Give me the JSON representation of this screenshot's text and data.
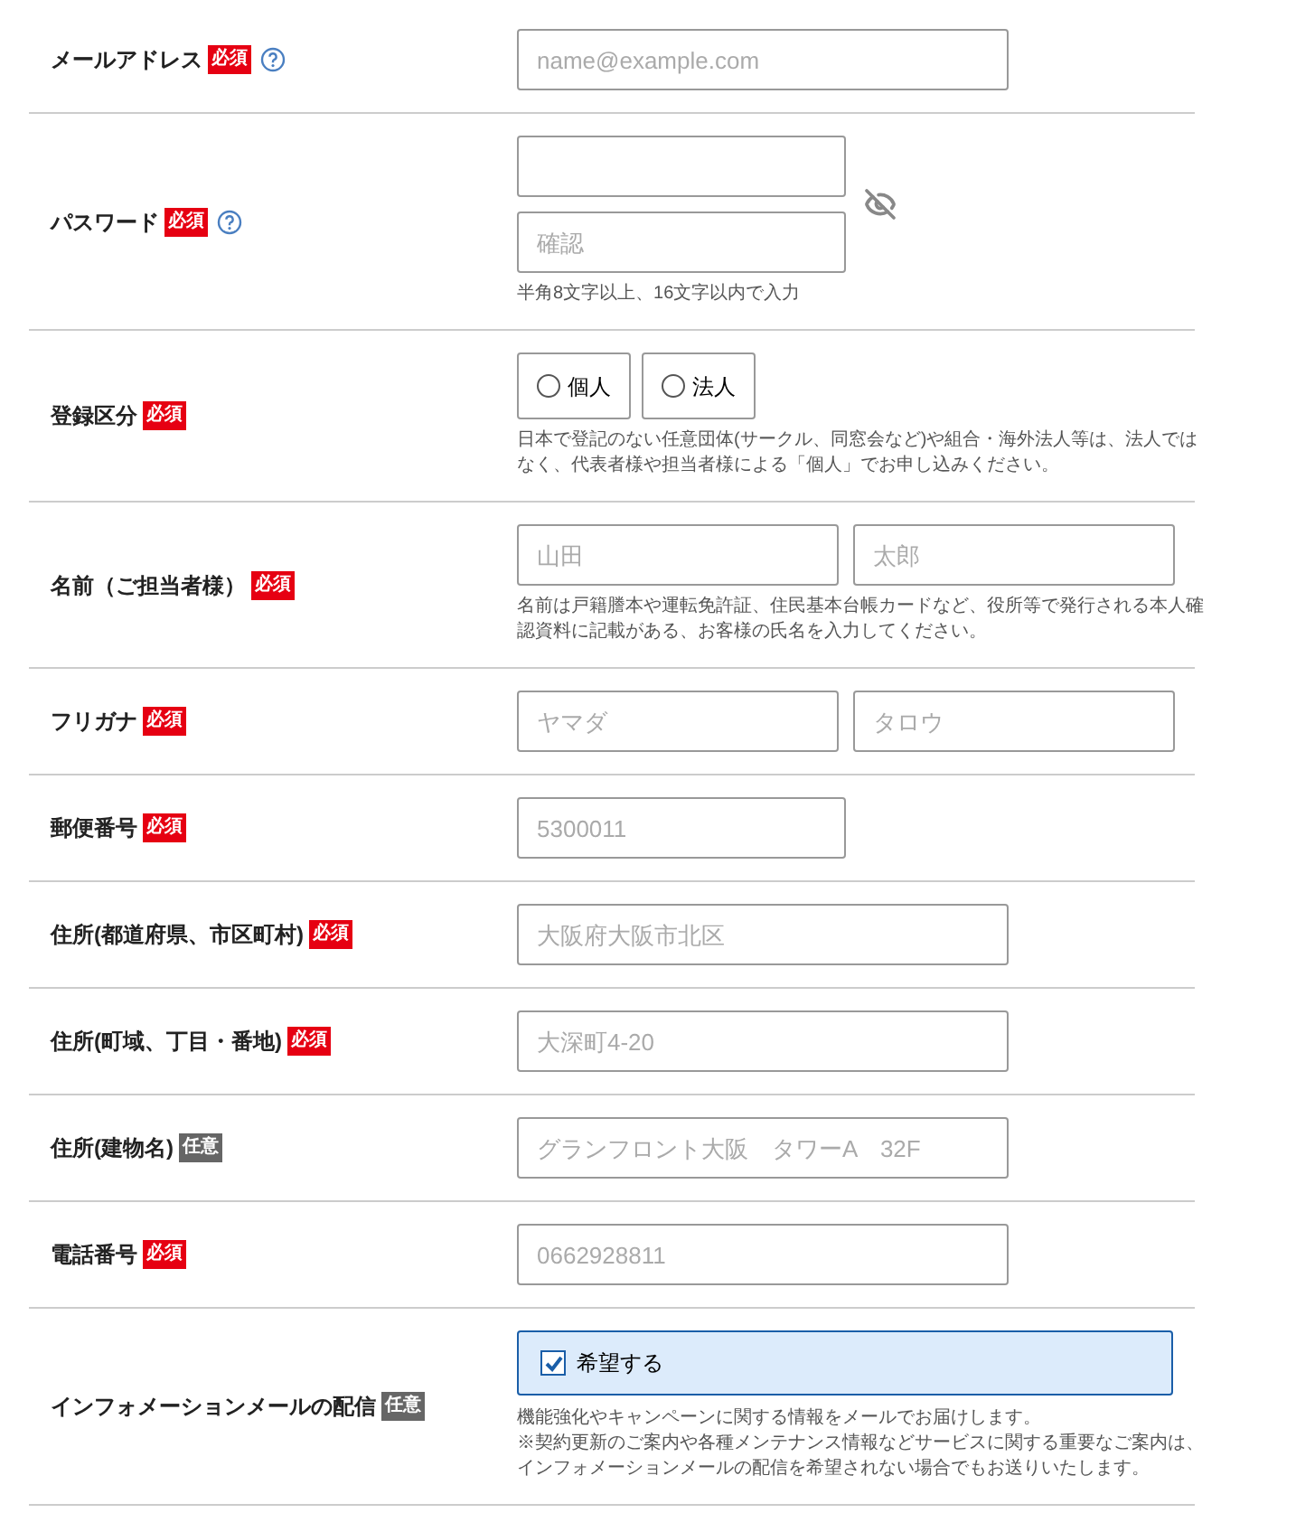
{
  "rows": [
    {
      "kind": "wide",
      "label": "メールアドレス",
      "badge": {
        "text": "必須",
        "kind": "required"
      },
      "help": true,
      "fields": [
        {
          "placeholder": "name@example.com"
        }
      ]
    },
    {
      "kind": "password",
      "label": "パスワード",
      "badge": {
        "text": "必須",
        "kind": "required"
      },
      "help": true,
      "password_visible": false,
      "confirm_field": {
        "placeholder": "確認"
      },
      "notes": [
        "半角8文字以上、16文字以内で入力"
      ]
    },
    {
      "kind": "radio",
      "label": "登録区分",
      "badge": {
        "text": "必須",
        "kind": "required"
      },
      "help": false,
      "options": [
        {
          "label": "個人",
          "selected": false
        },
        {
          "label": "法人",
          "selected": false
        }
      ],
      "notes": [
        "日本で登記のない任意団体(サークル、同窓会など)や組合・海外法人等は、法人ではなく、代表者様や担当者様による「個人」でお申し込みください。"
      ]
    },
    {
      "kind": "pair",
      "label": "名前（ご担当者様）",
      "badge": {
        "text": "必須",
        "kind": "required"
      },
      "help": false,
      "fields": [
        {
          "placeholder": "山田"
        },
        {
          "placeholder": "太郎"
        }
      ],
      "notes": [
        "名前は戸籍謄本や運転免許証、住民基本台帳カードなど、役所等で発行される本人確認資料に記載がある、お客様の氏名を入力してください。"
      ]
    },
    {
      "kind": "pair",
      "label": "フリガナ",
      "badge": {
        "text": "必須",
        "kind": "required"
      },
      "help": false,
      "fields": [
        {
          "placeholder": "ヤマダ"
        },
        {
          "placeholder": "タロウ"
        }
      ]
    },
    {
      "kind": "short",
      "label": "郵便番号",
      "badge": {
        "text": "必須",
        "kind": "required"
      },
      "help": false,
      "fields": [
        {
          "placeholder": "5300011"
        }
      ]
    },
    {
      "kind": "wide",
      "label": "住所(都道府県、市区町村)",
      "badge": {
        "text": "必須",
        "kind": "required"
      },
      "help": false,
      "fields": [
        {
          "placeholder": "大阪府大阪市北区"
        }
      ]
    },
    {
      "kind": "wide",
      "label": "住所(町域、丁目・番地)",
      "badge": {
        "text": "必須",
        "kind": "required"
      },
      "help": false,
      "fields": [
        {
          "placeholder": "大深町4-20"
        }
      ]
    },
    {
      "kind": "wide",
      "label": "住所(建物名)",
      "badge": {
        "text": "任意",
        "kind": "optional"
      },
      "help": false,
      "fields": [
        {
          "placeholder": "グランフロント大阪　タワーA　32F"
        }
      ]
    },
    {
      "kind": "wide",
      "label": "電話番号",
      "badge": {
        "text": "必須",
        "kind": "required"
      },
      "help": false,
      "fields": [
        {
          "placeholder": "0662928811"
        }
      ]
    },
    {
      "kind": "checkbox",
      "label": "インフォメーションメールの配信",
      "badge": {
        "text": "任意",
        "kind": "optional"
      },
      "help": false,
      "checkbox": {
        "label": "希望する",
        "checked": true
      },
      "notes": [
        "機能強化やキャンペーンに関する情報をメールでお届けします。",
        "※契約更新のご案内や各種メンテナンス情報などサービスに関する重要なご案内は、インフォメーションメールの配信を希望されない場合でもお送りいたします。"
      ]
    }
  ]
}
